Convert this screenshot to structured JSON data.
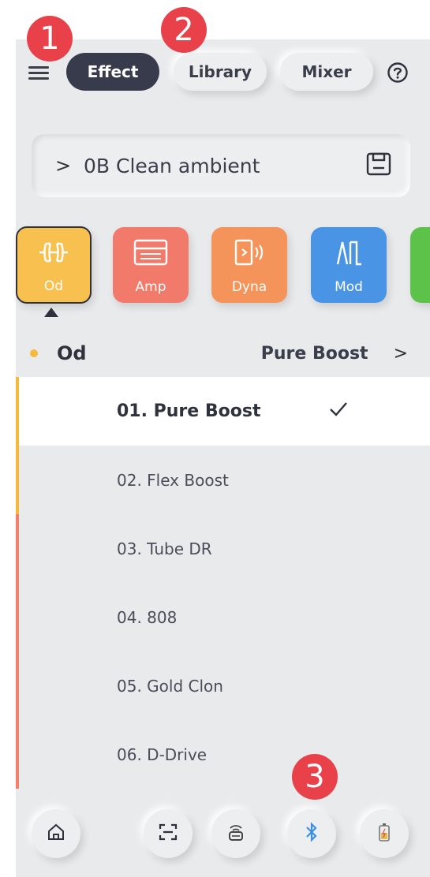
{
  "tabs": [
    {
      "label": "Effect",
      "active": true
    },
    {
      "label": "Library",
      "active": false
    },
    {
      "label": "Mixer",
      "active": false
    }
  ],
  "preset": {
    "name": "0B Clean ambient"
  },
  "modules": [
    {
      "label": "Od",
      "color": "#f8c14f",
      "icon": "od-icon",
      "selected": true
    },
    {
      "label": "Amp",
      "color": "#f27a6a",
      "icon": "amp-icon"
    },
    {
      "label": "Dyna",
      "color": "#f4935a",
      "icon": "dyna-icon"
    },
    {
      "label": "Mod",
      "color": "#4a94e6",
      "icon": "mod-icon"
    },
    {
      "label": "",
      "color": "#5cc24a",
      "icon": ""
    }
  ],
  "section": {
    "title": "Od",
    "current": "Pure Boost"
  },
  "list": {
    "items": [
      {
        "label": "01. Pure Boost",
        "selected": true
      },
      {
        "label": "02. Flex Boost"
      },
      {
        "label": "03. Tube DR"
      },
      {
        "label": "04. 808"
      },
      {
        "label": "05. Gold Clon"
      },
      {
        "label": "06. D-Drive"
      }
    ]
  },
  "bottom_nav": [
    "home-icon",
    "scan-icon",
    "connect-icon",
    "bluetooth-icon",
    "battery-icon"
  ],
  "annotations": [
    "1",
    "2",
    "3"
  ],
  "colors": {
    "accent": "#373b4b",
    "badge": "#e8414a",
    "bluetooth": "#3d8fe6"
  }
}
